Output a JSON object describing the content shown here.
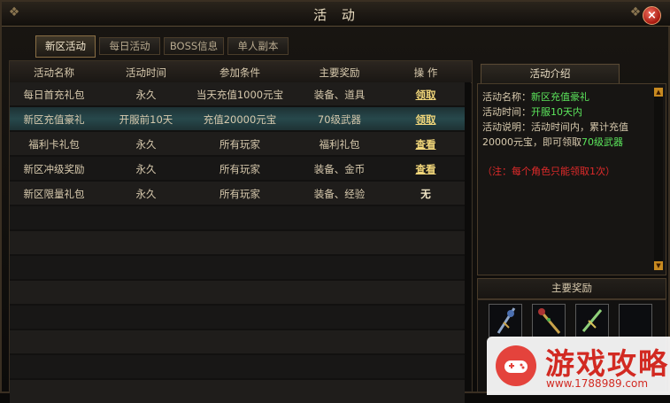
{
  "window": {
    "title": "活 动",
    "close_label": "×"
  },
  "tabs": [
    {
      "label": "新区活动",
      "active": true
    },
    {
      "label": "每日活动",
      "active": false
    },
    {
      "label": "BOSS信息",
      "active": false
    },
    {
      "label": "单人副本",
      "active": false
    }
  ],
  "table": {
    "headers": [
      "活动名称",
      "活动时间",
      "参加条件",
      "主要奖励",
      "操 作"
    ],
    "rows": [
      {
        "name": "每日首充礼包",
        "time": "永久",
        "condition": "当天充值1000元宝",
        "reward": "装备、道具",
        "action": "领取"
      },
      {
        "name": "新区充值豪礼",
        "time": "开服前10天",
        "condition": "充值20000元宝",
        "reward": "70级武器",
        "action": "领取"
      },
      {
        "name": "福利卡礼包",
        "time": "永久",
        "condition": "所有玩家",
        "reward": "福利礼包",
        "action": "查看"
      },
      {
        "name": "新区冲级奖励",
        "time": "永久",
        "condition": "所有玩家",
        "reward": "装备、金币",
        "action": "查看"
      },
      {
        "name": "新区限量礼包",
        "time": "永久",
        "condition": "所有玩家",
        "reward": "装备、经验",
        "action": "无"
      }
    ],
    "selected_row": 1
  },
  "intro": {
    "tab_label": "活动介绍",
    "name_label": "活动名称：",
    "name_value": "新区充值豪礼",
    "time_label": "活动时间：",
    "time_value": "开服10天内",
    "desc_line1": "活动说明：活动时间内，累计充值",
    "desc_line2_prefix": "20000元宝，即可领取",
    "desc_line2_value": "70级武器",
    "note": "（注：每个角色只能领取1次）"
  },
  "rewards": {
    "label": "主要奖励",
    "items": [
      "weapon-icon",
      "staff-icon",
      "blade-icon",
      "empty-slot"
    ]
  },
  "watermark": {
    "text": "游戏攻略",
    "url": "www.1788989.com"
  }
}
